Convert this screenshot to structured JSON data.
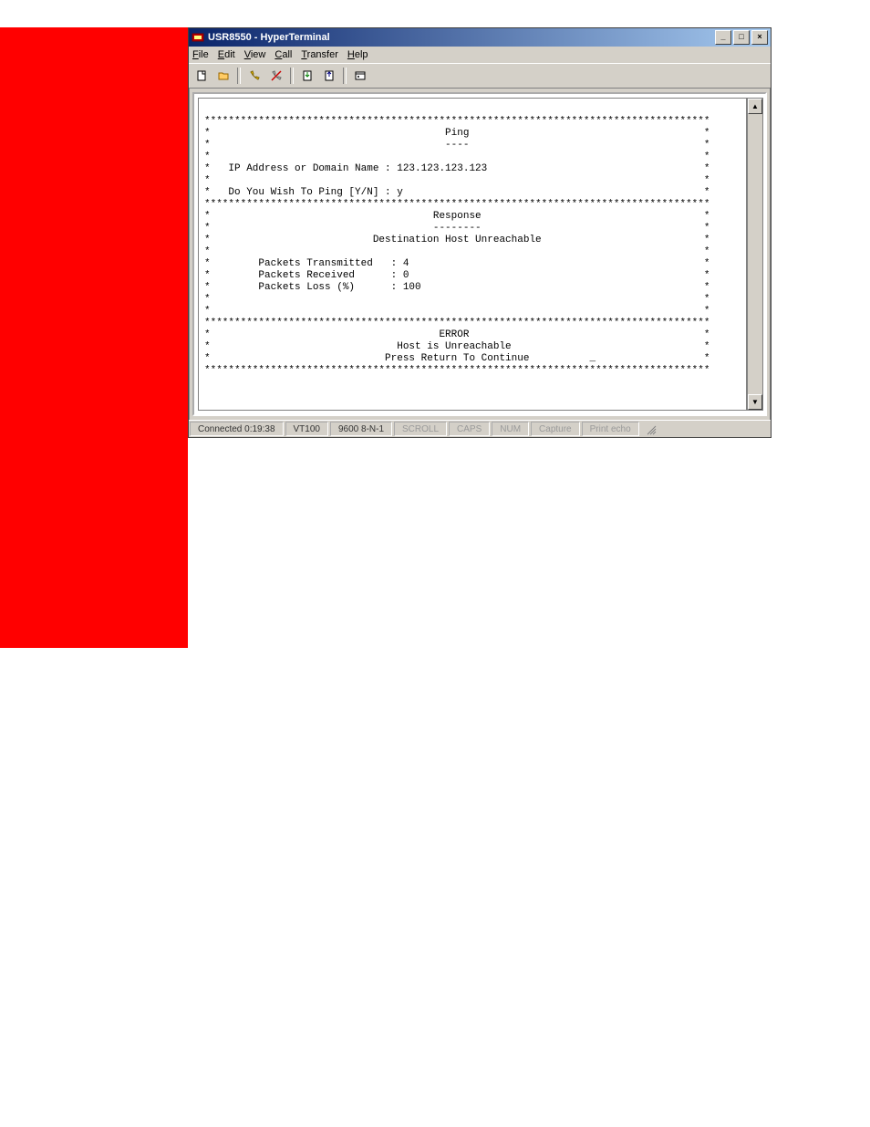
{
  "window": {
    "title": "USR8550 - HyperTerminal"
  },
  "menu": {
    "file": "File",
    "edit": "Edit",
    "view": "View",
    "call": "Call",
    "transfer": "Transfer",
    "help": "Help"
  },
  "terminal": {
    "section1_title": "Ping",
    "section1_underline": "----",
    "prompt_ip_label": "IP Address or Domain Name :",
    "prompt_ip_value": "123.123.123.123",
    "prompt_confirm_label": "Do You Wish To Ping [Y/N] :",
    "prompt_confirm_value": "y",
    "section2_title": "Response",
    "section2_underline": "--------",
    "response_message": "Destination Host Unreachable",
    "stat1_label": "Packets Transmitted",
    "stat1_value": "4",
    "stat2_label": "Packets Received",
    "stat2_value": "0",
    "stat3_label": "Packets Loss (%)",
    "stat3_value": "100",
    "section3_title": "ERROR",
    "error_message": "Host is Unreachable",
    "continue_prompt": "Press Return To Continue",
    "cursor": "_"
  },
  "status": {
    "connected": "Connected 0:19:38",
    "emulation": "VT100",
    "settings": "9600 8-N-1",
    "scroll": "SCROLL",
    "caps": "CAPS",
    "num": "NUM",
    "capture": "Capture",
    "printecho": "Print echo"
  }
}
